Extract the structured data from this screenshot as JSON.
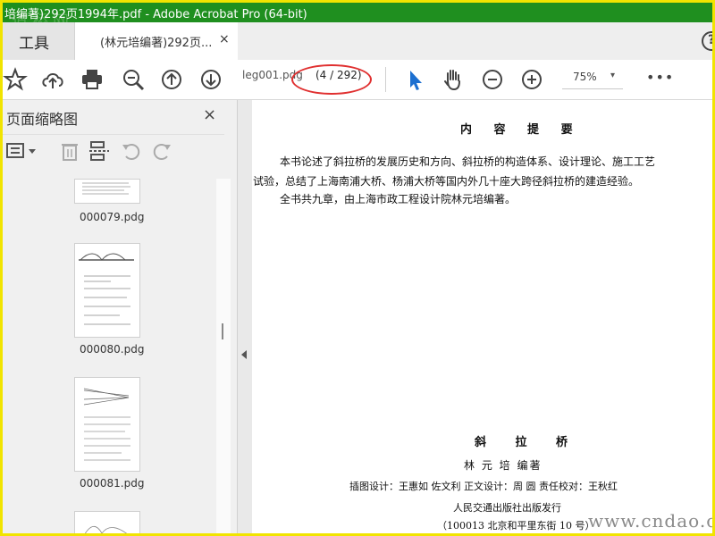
{
  "window": {
    "title": "培编著)292页1994年.pdf - Adobe Acrobat Pro (64-bit)",
    "watermark_logo": "道桥网"
  },
  "tabs": {
    "tools_label": "工具",
    "doc_tab_label": "(林元培编著)292页...",
    "doc_tab_close": "×",
    "help_symbol": "?"
  },
  "toolbar": {
    "page_label_field": "leg001.pdg",
    "page_count": "(4 / 292)",
    "zoom_value": "75%",
    "zoom_caret": "▾",
    "more": "•••",
    "icons": [
      "bookmark-star-icon",
      "upload-cloud-icon",
      "print-icon",
      "zoom-search-icon",
      "prev-page-icon",
      "next-page-icon",
      "select-arrow-icon",
      "hand-tool-icon",
      "zoom-out-icon",
      "zoom-in-icon"
    ]
  },
  "sidebar": {
    "title": "页面缩略图",
    "close": "×",
    "thumbnails": [
      {
        "label": "000079.pdg"
      },
      {
        "label": "000080.pdg"
      },
      {
        "label": "000081.pdg"
      }
    ]
  },
  "document": {
    "heading": "内 容 提 要",
    "body_line1": "本书论述了斜拉桥的发展历史和方向、斜拉桥的构造体系、设计理论、施工工艺",
    "body_line2": "试验，总结了上海南浦大桥、杨浦大桥等国内外几十座大跨径斜拉桥的建造经验。",
    "body_line3": "全书共九章，由上海市政工程设计院林元培编著。",
    "book_title": "斜 拉 桥",
    "author_line": "林 元 培    编著",
    "credits_line": "插图设计：王惠如   佐文利  正文设计：周   圆  责任校对：王秋红",
    "publisher_line": "人民交通出版社出版发行",
    "address_line": "（100013  北京和平里东街 10 号）"
  },
  "page_watermark": "www.cndao.com",
  "colors": {
    "title_bar": "#1f8f1f",
    "highlight_circle": "#e03030",
    "select_tool": "#1c6fd0",
    "frame": "#f1e400"
  }
}
